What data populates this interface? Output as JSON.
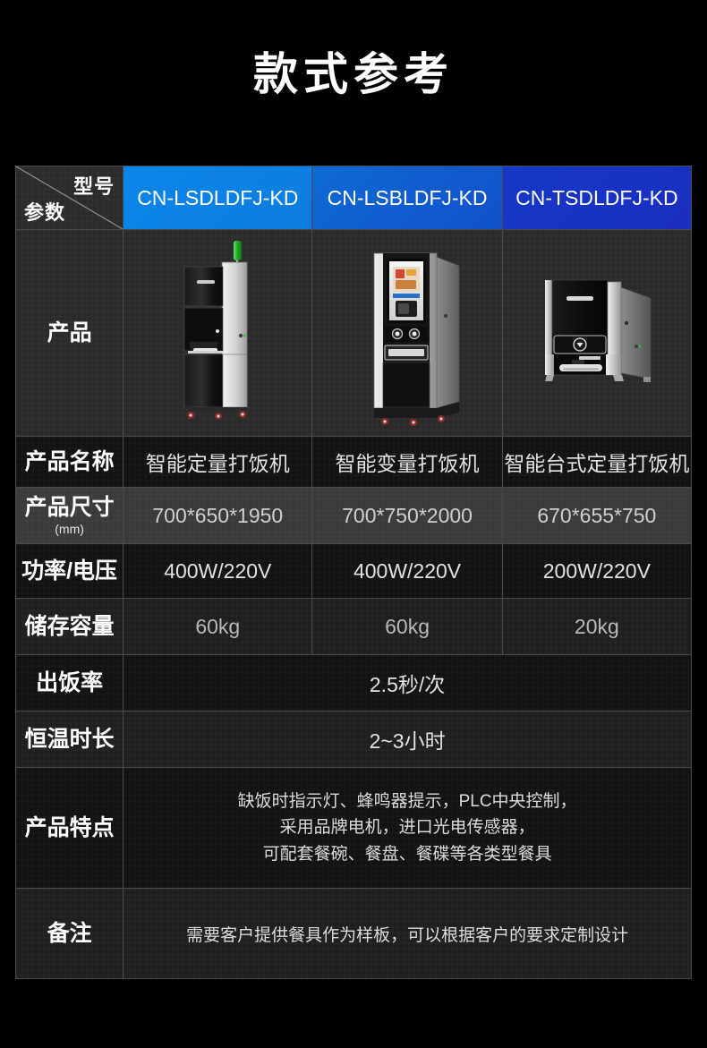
{
  "page": {
    "title": "款式参考",
    "background_color": "#000000"
  },
  "table": {
    "corner": {
      "top_label": "型号",
      "bottom_label": "参数"
    },
    "models": [
      {
        "name": "CN-LSDLDFJ-KD",
        "accent": "#0c82e0"
      },
      {
        "name": "CN-LSBLDFJ-KD",
        "accent": "#115ccf"
      },
      {
        "name": "CN-TSDLDFJ-KD",
        "accent": "#1733c3"
      }
    ],
    "rows": {
      "product_image": {
        "label": "产品"
      },
      "product_name": {
        "label": "产品名称",
        "values": [
          "智能定量打饭机",
          "智能变量打饭机",
          "智能台式定量打饭机"
        ]
      },
      "product_size": {
        "label": "产品尺寸",
        "unit": "(mm)",
        "values": [
          "700*650*1950",
          "700*750*2000",
          "670*655*750"
        ]
      },
      "power_voltage": {
        "label": "功率/电压",
        "values": [
          "400W/220V",
          "400W/220V",
          "200W/220V"
        ]
      },
      "storage_capacity": {
        "label": "储存容量",
        "values": [
          "60kg",
          "60kg",
          "20kg"
        ]
      },
      "dispense_rate": {
        "label": "出饭率",
        "value": "2.5秒/次"
      },
      "warm_duration": {
        "label": "恒温时长",
        "value": "2~3小时"
      },
      "features": {
        "label": "产品特点",
        "lines": [
          "缺饭时指示灯、蜂鸣器提示，PLC中央控制，",
          "采用品牌电机，进口光电传感器，",
          "可配套餐碗、餐盘、餐碟等各类型餐具"
        ]
      },
      "remarks": {
        "label": "备注",
        "value": "需要客户提供餐具作为样板，可以根据客户的要求定制设计"
      }
    }
  }
}
